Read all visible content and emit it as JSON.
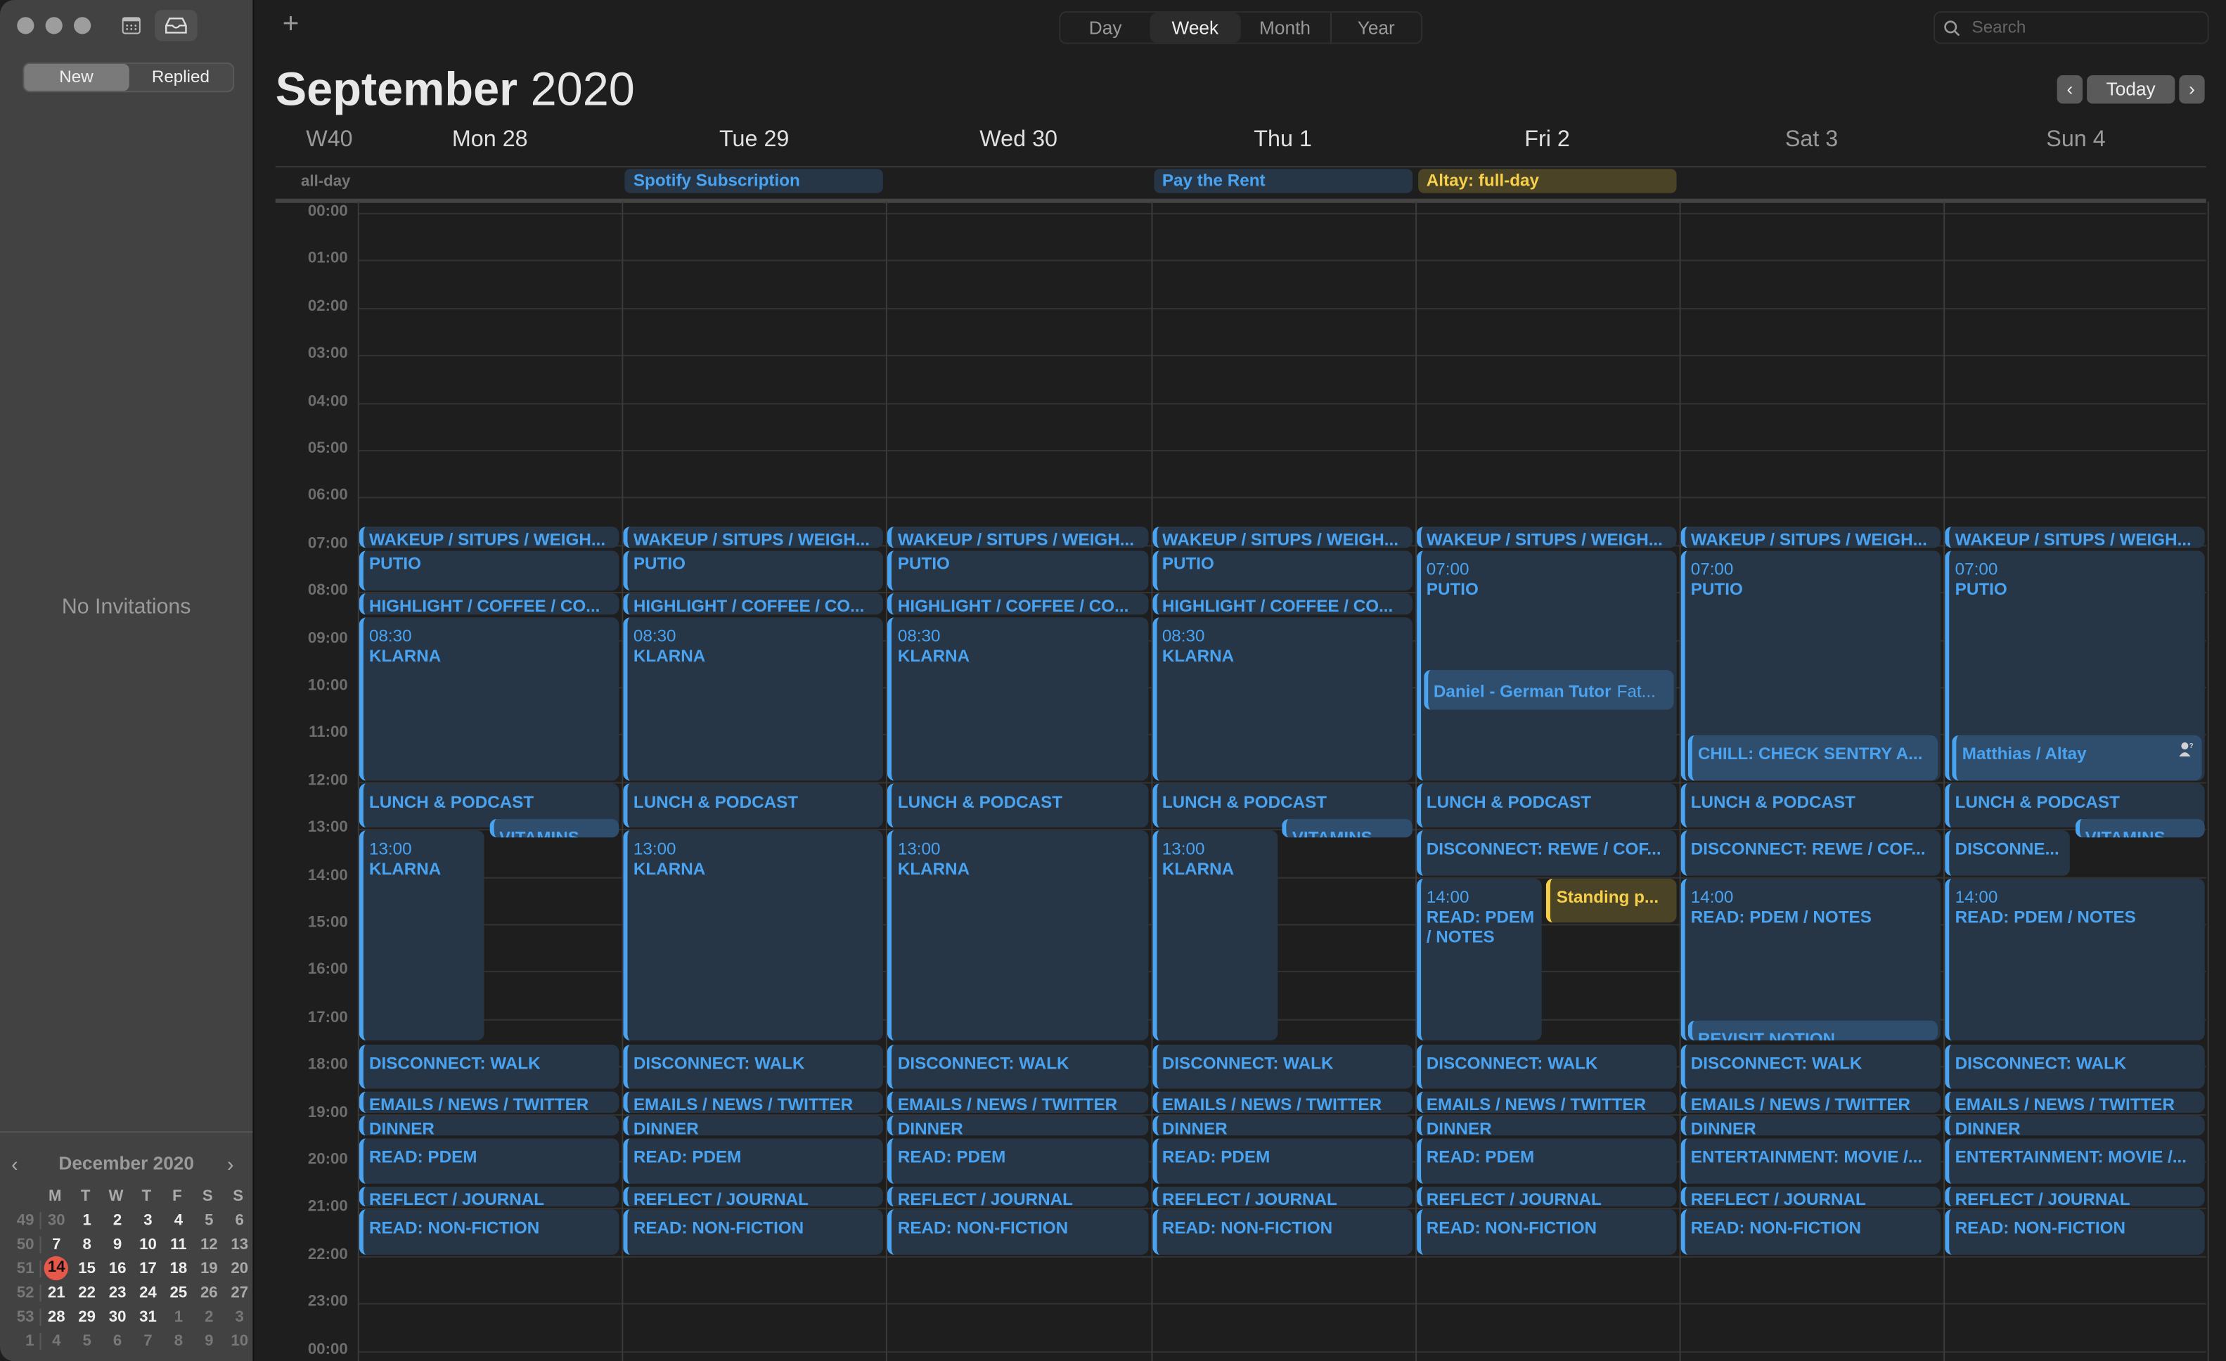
{
  "window": {
    "controls": [
      "close",
      "minimize",
      "zoom"
    ]
  },
  "sidebar": {
    "icons": [
      "calendar-list-icon",
      "inbox-icon"
    ],
    "segments": [
      {
        "label": "New",
        "active": true
      },
      {
        "label": "Replied",
        "active": false
      }
    ],
    "empty_text": "No Invitations",
    "mini_calendar": {
      "title": "December 2020",
      "weekday_headers": [
        "M",
        "T",
        "W",
        "T",
        "F",
        "S",
        "S"
      ],
      "today": 14,
      "weeks": [
        {
          "week": "49",
          "days": [
            "30",
            "1",
            "2",
            "3",
            "4",
            "5",
            "6"
          ],
          "dim": [
            0
          ]
        },
        {
          "week": "50",
          "days": [
            "7",
            "8",
            "9",
            "10",
            "11",
            "12",
            "13"
          ],
          "dim": []
        },
        {
          "week": "51",
          "days": [
            "14",
            "15",
            "16",
            "17",
            "18",
            "19",
            "20"
          ],
          "dim": []
        },
        {
          "week": "52",
          "days": [
            "21",
            "22",
            "23",
            "24",
            "25",
            "26",
            "27"
          ],
          "dim": []
        },
        {
          "week": "53",
          "days": [
            "28",
            "29",
            "30",
            "31",
            "1",
            "2",
            "3"
          ],
          "dim": [
            4,
            5,
            6
          ]
        },
        {
          "week": "1",
          "days": [
            "4",
            "5",
            "6",
            "7",
            "8",
            "9",
            "10"
          ],
          "dim": [
            0,
            1,
            2,
            3,
            4,
            5,
            6
          ]
        }
      ]
    }
  },
  "toolbar": {
    "add_label": "+",
    "views": [
      {
        "label": "Day",
        "active": false
      },
      {
        "label": "Week",
        "active": true
      },
      {
        "label": "Month",
        "active": false
      },
      {
        "label": "Year",
        "active": false
      }
    ],
    "search_placeholder": "Search"
  },
  "header": {
    "month": "September",
    "year": "2020",
    "today_label": "Today",
    "prev_icon": "‹",
    "next_icon": "›",
    "week_label": "W40",
    "days": [
      {
        "label": "Mon 28",
        "weekend": false
      },
      {
        "label": "Tue 29",
        "weekend": false
      },
      {
        "label": "Wed 30",
        "weekend": false
      },
      {
        "label": "Thu 1",
        "weekend": false
      },
      {
        "label": "Fri 2",
        "weekend": false
      },
      {
        "label": "Sat 3",
        "weekend": true
      },
      {
        "label": "Sun 4",
        "weekend": true
      }
    ]
  },
  "all_day": {
    "label": "all-day",
    "events": [
      {
        "day": 1,
        "title": "Spotify Subscription",
        "color": "blue"
      },
      {
        "day": 3,
        "title": "Pay the Rent",
        "color": "blue"
      },
      {
        "day": 4,
        "title": "Altay: full-day",
        "color": "yellow"
      }
    ]
  },
  "hours": [
    "00:00",
    "01:00",
    "02:00",
    "03:00",
    "04:00",
    "05:00",
    "06:00",
    "07:00",
    "08:00",
    "09:00",
    "10:00",
    "11:00",
    "12:00",
    "13:00",
    "14:00",
    "15:00",
    "16:00",
    "17:00",
    "18:00",
    "19:00",
    "20:00",
    "21:00",
    "22:00",
    "23:00",
    "00:00"
  ],
  "colors": {
    "event_blue": "#4aa3f0",
    "event_yellow": "#f7d04a",
    "today_red": "#e5584a"
  },
  "events": [
    {
      "day": 0,
      "start": 6.6,
      "end": 7.1,
      "title": "WAKEUP / SITUPS / WEIGH..."
    },
    {
      "day": 0,
      "start": 7.1,
      "end": 8.0,
      "title": "PUTIO"
    },
    {
      "day": 0,
      "start": 8.0,
      "end": 8.5,
      "title": "HIGHLIGHT / COFFEE / CO..."
    },
    {
      "day": 0,
      "start": 8.5,
      "end": 12.0,
      "time": "08:30",
      "title": "KLARNA"
    },
    {
      "day": 0,
      "start": 12.0,
      "end": 13.0,
      "title": "LUNCH & PODCAST"
    },
    {
      "day": 0,
      "start": 12.75,
      "end": 13.2,
      "title": "VITAMINS",
      "col": 1,
      "cols": 2,
      "light": true
    },
    {
      "day": 0,
      "start": 13.0,
      "end": 17.5,
      "time": "13:00",
      "title": "KLARNA",
      "col": 0,
      "cols": 2
    },
    {
      "day": 0,
      "start": 17.5,
      "end": 18.5,
      "title": "DISCONNECT: WALK"
    },
    {
      "day": 0,
      "start": 18.5,
      "end": 19.0,
      "title": "EMAILS / NEWS / TWITTER"
    },
    {
      "day": 0,
      "start": 19.0,
      "end": 19.5,
      "title": "DINNER"
    },
    {
      "day": 0,
      "start": 19.5,
      "end": 20.5,
      "title": "READ: PDEM"
    },
    {
      "day": 0,
      "start": 20.5,
      "end": 21.0,
      "title": "REFLECT / JOURNAL"
    },
    {
      "day": 0,
      "start": 21.0,
      "end": 22.0,
      "title": "READ: NON-FICTION"
    },
    {
      "day": 1,
      "start": 6.6,
      "end": 7.1,
      "title": "WAKEUP / SITUPS / WEIGH..."
    },
    {
      "day": 1,
      "start": 7.1,
      "end": 8.0,
      "title": "PUTIO"
    },
    {
      "day": 1,
      "start": 8.0,
      "end": 8.5,
      "title": "HIGHLIGHT / COFFEE / CO..."
    },
    {
      "day": 1,
      "start": 8.5,
      "end": 12.0,
      "time": "08:30",
      "title": "KLARNA"
    },
    {
      "day": 1,
      "start": 12.0,
      "end": 13.0,
      "title": "LUNCH & PODCAST"
    },
    {
      "day": 1,
      "start": 13.0,
      "end": 17.5,
      "time": "13:00",
      "title": "KLARNA"
    },
    {
      "day": 1,
      "start": 17.5,
      "end": 18.5,
      "title": "DISCONNECT: WALK"
    },
    {
      "day": 1,
      "start": 18.5,
      "end": 19.0,
      "title": "EMAILS / NEWS / TWITTER"
    },
    {
      "day": 1,
      "start": 19.0,
      "end": 19.5,
      "title": "DINNER"
    },
    {
      "day": 1,
      "start": 19.5,
      "end": 20.5,
      "title": "READ: PDEM"
    },
    {
      "day": 1,
      "start": 20.5,
      "end": 21.0,
      "title": "REFLECT / JOURNAL"
    },
    {
      "day": 1,
      "start": 21.0,
      "end": 22.0,
      "title": "READ: NON-FICTION"
    },
    {
      "day": 2,
      "start": 6.6,
      "end": 7.1,
      "title": "WAKEUP / SITUPS / WEIGH..."
    },
    {
      "day": 2,
      "start": 7.1,
      "end": 8.0,
      "title": "PUTIO"
    },
    {
      "day": 2,
      "start": 8.0,
      "end": 8.5,
      "title": "HIGHLIGHT / COFFEE / CO..."
    },
    {
      "day": 2,
      "start": 8.5,
      "end": 12.0,
      "time": "08:30",
      "title": "KLARNA"
    },
    {
      "day": 2,
      "start": 12.0,
      "end": 13.0,
      "title": "LUNCH & PODCAST"
    },
    {
      "day": 2,
      "start": 13.0,
      "end": 17.5,
      "time": "13:00",
      "title": "KLARNA"
    },
    {
      "day": 2,
      "start": 17.5,
      "end": 18.5,
      "title": "DISCONNECT: WALK"
    },
    {
      "day": 2,
      "start": 18.5,
      "end": 19.0,
      "title": "EMAILS / NEWS / TWITTER"
    },
    {
      "day": 2,
      "start": 19.0,
      "end": 19.5,
      "title": "DINNER"
    },
    {
      "day": 2,
      "start": 19.5,
      "end": 20.5,
      "title": "READ: PDEM"
    },
    {
      "day": 2,
      "start": 20.5,
      "end": 21.0,
      "title": "REFLECT / JOURNAL"
    },
    {
      "day": 2,
      "start": 21.0,
      "end": 22.0,
      "title": "READ: NON-FICTION"
    },
    {
      "day": 3,
      "start": 6.6,
      "end": 7.1,
      "title": "WAKEUP / SITUPS / WEIGH..."
    },
    {
      "day": 3,
      "start": 7.1,
      "end": 8.0,
      "title": "PUTIO"
    },
    {
      "day": 3,
      "start": 8.0,
      "end": 8.5,
      "title": "HIGHLIGHT / COFFEE / CO..."
    },
    {
      "day": 3,
      "start": 8.5,
      "end": 12.0,
      "time": "08:30",
      "title": "KLARNA"
    },
    {
      "day": 3,
      "start": 12.0,
      "end": 13.0,
      "title": "LUNCH & PODCAST"
    },
    {
      "day": 3,
      "start": 12.75,
      "end": 13.2,
      "title": "VITAMINS",
      "col": 1,
      "cols": 2,
      "light": true
    },
    {
      "day": 3,
      "start": 13.0,
      "end": 17.5,
      "time": "13:00",
      "title": "KLARNA",
      "col": 0,
      "cols": 2
    },
    {
      "day": 3,
      "start": 17.5,
      "end": 18.5,
      "title": "DISCONNECT: WALK"
    },
    {
      "day": 3,
      "start": 18.5,
      "end": 19.0,
      "title": "EMAILS / NEWS / TWITTER"
    },
    {
      "day": 3,
      "start": 19.0,
      "end": 19.5,
      "title": "DINNER"
    },
    {
      "day": 3,
      "start": 19.5,
      "end": 20.5,
      "title": "READ: PDEM"
    },
    {
      "day": 3,
      "start": 20.5,
      "end": 21.0,
      "title": "REFLECT / JOURNAL"
    },
    {
      "day": 3,
      "start": 21.0,
      "end": 22.0,
      "title": "READ: NON-FICTION"
    },
    {
      "day": 4,
      "start": 6.6,
      "end": 7.1,
      "title": "WAKEUP / SITUPS / WEIGH..."
    },
    {
      "day": 4,
      "start": 7.1,
      "end": 12.0,
      "time": "07:00",
      "title": "PUTIO"
    },
    {
      "day": 4,
      "start": 9.6,
      "end": 10.5,
      "title": "Daniel - German Tutor",
      "subtitle": "Fat...",
      "light": true,
      "inset": true,
      "mixed": true
    },
    {
      "day": 4,
      "start": 12.0,
      "end": 13.0,
      "title": "LUNCH & PODCAST"
    },
    {
      "day": 4,
      "start": 13.0,
      "end": 14.0,
      "title": "DISCONNECT: REWE / COF..."
    },
    {
      "day": 4,
      "start": 14.0,
      "end": 17.5,
      "time": "14:00",
      "title": "READ: PDEM / NOTES",
      "col": 0,
      "cols": 2,
      "wrap": true
    },
    {
      "day": 4,
      "start": 14.0,
      "end": 15.0,
      "title": "Standing p...",
      "col": 1,
      "cols": 2,
      "color": "yellow",
      "mixed": true
    },
    {
      "day": 4,
      "start": 17.5,
      "end": 18.5,
      "title": "DISCONNECT: WALK"
    },
    {
      "day": 4,
      "start": 18.5,
      "end": 19.0,
      "title": "EMAILS / NEWS / TWITTER"
    },
    {
      "day": 4,
      "start": 19.0,
      "end": 19.5,
      "title": "DINNER"
    },
    {
      "day": 4,
      "start": 19.5,
      "end": 20.5,
      "title": "READ: PDEM"
    },
    {
      "day": 4,
      "start": 20.5,
      "end": 21.0,
      "title": "REFLECT / JOURNAL"
    },
    {
      "day": 4,
      "start": 21.0,
      "end": 22.0,
      "title": "READ: NON-FICTION"
    },
    {
      "day": 5,
      "start": 6.6,
      "end": 7.1,
      "title": "WAKEUP / SITUPS / WEIGH..."
    },
    {
      "day": 5,
      "start": 7.1,
      "end": 12.0,
      "time": "07:00",
      "title": "PUTIO"
    },
    {
      "day": 5,
      "start": 11.0,
      "end": 12.0,
      "title": "CHILL: CHECK SENTRY A...",
      "light": true,
      "inset": true
    },
    {
      "day": 5,
      "start": 12.0,
      "end": 13.0,
      "title": "LUNCH & PODCAST"
    },
    {
      "day": 5,
      "start": 13.0,
      "end": 14.0,
      "title": "DISCONNECT: REWE / COF..."
    },
    {
      "day": 5,
      "start": 14.0,
      "end": 17.5,
      "time": "14:00",
      "title": "READ: PDEM / NOTES"
    },
    {
      "day": 5,
      "start": 17.0,
      "end": 17.5,
      "title": "REVISIT NOTION",
      "light": true,
      "inset": true
    },
    {
      "day": 5,
      "start": 17.5,
      "end": 18.5,
      "title": "DISCONNECT: WALK"
    },
    {
      "day": 5,
      "start": 18.5,
      "end": 19.0,
      "title": "EMAILS / NEWS / TWITTER"
    },
    {
      "day": 5,
      "start": 19.0,
      "end": 19.5,
      "title": "DINNER"
    },
    {
      "day": 5,
      "start": 19.5,
      "end": 20.5,
      "title": "ENTERTAINMENT: MOVIE /..."
    },
    {
      "day": 5,
      "start": 20.5,
      "end": 21.0,
      "title": "REFLECT / JOURNAL"
    },
    {
      "day": 5,
      "start": 21.0,
      "end": 22.0,
      "title": "READ: NON-FICTION"
    },
    {
      "day": 6,
      "start": 6.6,
      "end": 7.1,
      "title": "WAKEUP / SITUPS / WEIGH..."
    },
    {
      "day": 6,
      "start": 7.1,
      "end": 12.0,
      "time": "07:00",
      "title": "PUTIO"
    },
    {
      "day": 6,
      "start": 11.0,
      "end": 12.0,
      "title": "Matthias / Altay",
      "light": true,
      "inset": true,
      "mixed": true,
      "invitee_icon": "person-question-icon"
    },
    {
      "day": 6,
      "start": 12.0,
      "end": 13.0,
      "title": "LUNCH & PODCAST"
    },
    {
      "day": 6,
      "start": 12.75,
      "end": 13.2,
      "title": "VITAMINS",
      "col": 1,
      "cols": 2,
      "light": true
    },
    {
      "day": 6,
      "start": 13.0,
      "end": 14.0,
      "title": "DISCONNE...",
      "col": 0,
      "cols": 2
    },
    {
      "day": 6,
      "start": 14.0,
      "end": 17.5,
      "time": "14:00",
      "title": "READ: PDEM / NOTES"
    },
    {
      "day": 6,
      "start": 17.5,
      "end": 18.5,
      "title": "DISCONNECT: WALK"
    },
    {
      "day": 6,
      "start": 18.5,
      "end": 19.0,
      "title": "EMAILS / NEWS / TWITTER"
    },
    {
      "day": 6,
      "start": 19.0,
      "end": 19.5,
      "title": "DINNER"
    },
    {
      "day": 6,
      "start": 19.5,
      "end": 20.5,
      "title": "ENTERTAINMENT: MOVIE /..."
    },
    {
      "day": 6,
      "start": 20.5,
      "end": 21.0,
      "title": "REFLECT / JOURNAL"
    },
    {
      "day": 6,
      "start": 21.0,
      "end": 22.0,
      "title": "READ: NON-FICTION"
    }
  ]
}
